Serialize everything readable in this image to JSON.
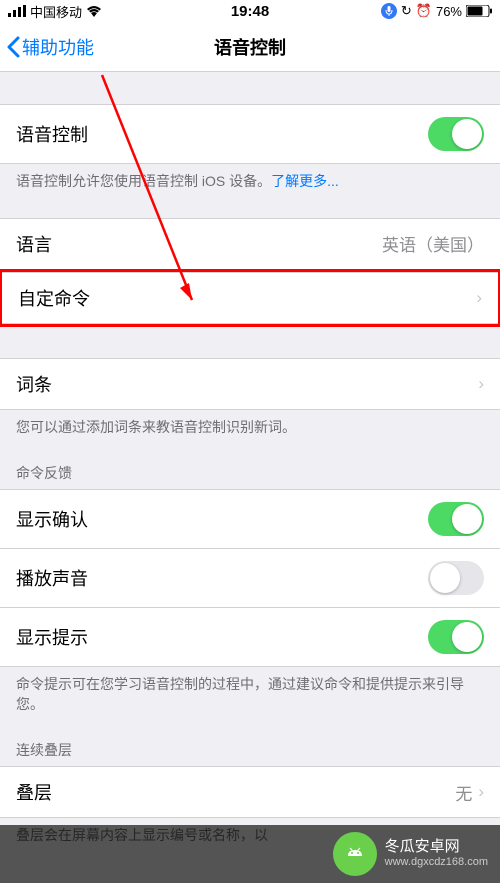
{
  "status": {
    "carrier": "中国移动",
    "time": "19:48",
    "battery_pct": "76%"
  },
  "nav": {
    "back_label": "辅助功能",
    "title": "语音控制"
  },
  "voice_control": {
    "label": "语音控制",
    "enabled": true,
    "footer_pre": "语音控制允许您使用语音控制 iOS 设备。",
    "footer_link": "了解更多..."
  },
  "language": {
    "label": "语言",
    "value": "英语（美国）"
  },
  "custom_commands": {
    "label": "自定命令"
  },
  "vocabulary": {
    "label": "词条",
    "footer": "您可以通过添加词条来教语音控制识别新词。"
  },
  "feedback": {
    "header": "命令反馈",
    "show_confirm": {
      "label": "显示确认",
      "enabled": true
    },
    "play_sound": {
      "label": "播放声音",
      "enabled": false
    },
    "show_hints": {
      "label": "显示提示",
      "enabled": true
    },
    "footer": "命令提示可在您学习语音控制的过程中，通过建议命令和提供提示来引导您。"
  },
  "overlay": {
    "header": "连续叠层",
    "label": "叠层",
    "value": "无",
    "footer": "叠层会在屏幕内容上显示编号或名称，以"
  },
  "watermark": {
    "title": "冬瓜安卓网",
    "url": "www.dgxcdz168.com"
  }
}
